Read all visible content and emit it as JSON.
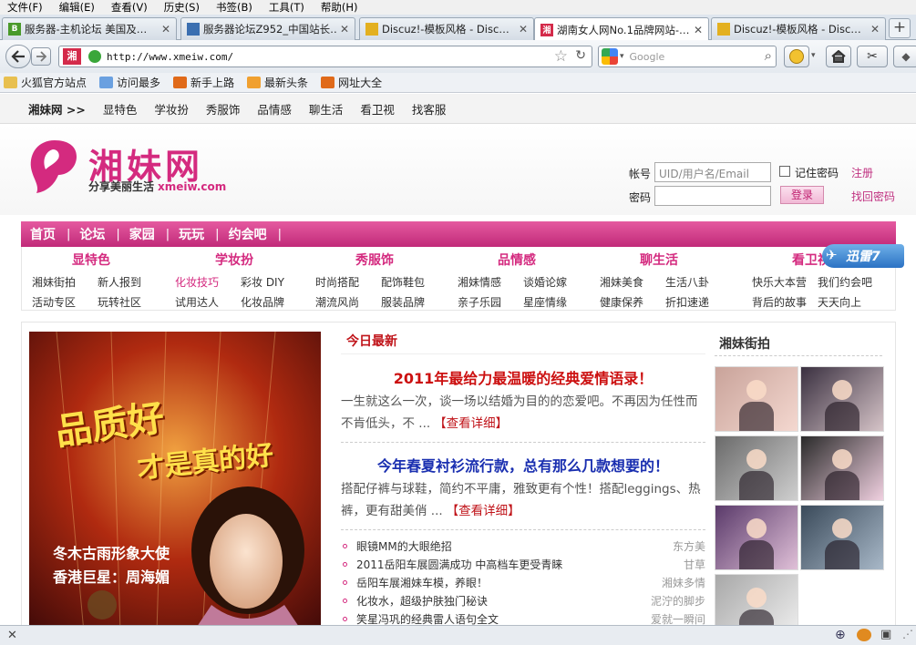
{
  "menu": [
    "文件(F)",
    "编辑(E)",
    "查看(V)",
    "历史(S)",
    "书签(B)",
    "工具(T)",
    "帮助(H)"
  ],
  "tabs": [
    {
      "title": "服务器-主机论坛  美国及…",
      "icon_color": "#4a9a2a",
      "icon_text": "B"
    },
    {
      "title": "服务器论坛Z952_中国站长…",
      "icon_color": "#3b6fb0",
      "icon_text": ""
    },
    {
      "title": "Discuz!-模板风格 - Disc…",
      "icon_color": "#e3b020",
      "icon_text": ""
    },
    {
      "title": "湖南女人网No.1品牌网站-…",
      "icon_color": "#d42a4a",
      "icon_text": "湘"
    },
    {
      "title": "Discuz!-模板风格 - Disc…",
      "icon_color": "#e3b020",
      "icon_text": ""
    }
  ],
  "url": "http://www.xmeiw.com/",
  "search_placeholder": "Google",
  "bookmarks": [
    {
      "label": "火狐官方站点",
      "color": "#e8c050"
    },
    {
      "label": "访问最多",
      "color": "#6aa0e0"
    },
    {
      "label": "新手上路",
      "color": "#e06a1a"
    },
    {
      "label": "最新头条",
      "color": "#f0a030"
    },
    {
      "label": "网址大全",
      "color": "#e06a1a"
    }
  ],
  "topnav": [
    "湘妹网 >>",
    "显特色",
    "学妆扮",
    "秀服饰",
    "品情感",
    "聊生活",
    "看卫视",
    "找客服"
  ],
  "logo": {
    "name": "湘妹网",
    "slogan": "分享美丽生活",
    "domain": "xmeiw.com"
  },
  "login": {
    "account_label": "帐号",
    "account_placeholder": "UID/用户名/Email",
    "password_label": "密码",
    "remember_label": "记住密码",
    "login_button": "登录",
    "register": "注册",
    "forgot": "找回密码"
  },
  "mainnav": [
    "首页",
    "论坛",
    "家园",
    "玩玩",
    "约会吧"
  ],
  "categories": [
    {
      "title": "显特色",
      "links": [
        "湘妹街拍",
        "新人报到",
        "活动专区",
        "玩转社区"
      ]
    },
    {
      "title": "学妆扮",
      "links": [
        "化妆技巧",
        "彩妆 DIY",
        "试用达人",
        "化妆品牌"
      ]
    },
    {
      "title": "秀服饰",
      "links": [
        "时尚搭配",
        "配饰鞋包",
        "潮流风尚",
        "服装品牌"
      ]
    },
    {
      "title": "品情感",
      "links": [
        "湘妹情感",
        "谈婚论嫁",
        "亲子乐园",
        "星座情缘"
      ]
    },
    {
      "title": "聊生活",
      "links": [
        "湘妹美食",
        "生活八卦",
        "健康保养",
        "折扣速递"
      ]
    },
    {
      "title": "看卫视",
      "links": [
        "快乐大本营",
        "我们约会吧",
        "背后的故事",
        "天天向上"
      ]
    }
  ],
  "xunlei": "迅雷7",
  "banner": {
    "line1": "品质好",
    "line2": "才是真的好",
    "caption1": "冬木古雨形象大使",
    "caption2": "香港巨星：周海媚"
  },
  "news": {
    "section": "今日最新",
    "headline1": "2011年最给力最温暖的经典爱情语录！",
    "para1": "一生就这么一次，谈一场以结婚为目的的恋爱吧。不再因为任性而不肯低头，不 ...",
    "headline2": "今年春夏衬衫流行款，总有那么几款想要的！",
    "para2": "搭配仔裤与球鞋，简约不平庸，雅致更有个性！搭配leggings、热裤，更有甜美俏 ...",
    "more": "【查看详细】",
    "list": [
      {
        "title": "眼镜MM的大眼绝招",
        "author": "东方美"
      },
      {
        "title": "2011岳阳车展圆满成功 中高档车更受青睐",
        "author": "甘草"
      },
      {
        "title": "岳阳车展湘妹车模，养眼！",
        "author": "湘妹多情"
      },
      {
        "title": "化妆水，超级护肤独门秘诀",
        "author": "泥泞的脚步"
      },
      {
        "title": "笑星冯巩的经典雷人语句全文",
        "author": "爱就一瞬间"
      }
    ]
  },
  "street": {
    "section": "湘妹街拍"
  }
}
